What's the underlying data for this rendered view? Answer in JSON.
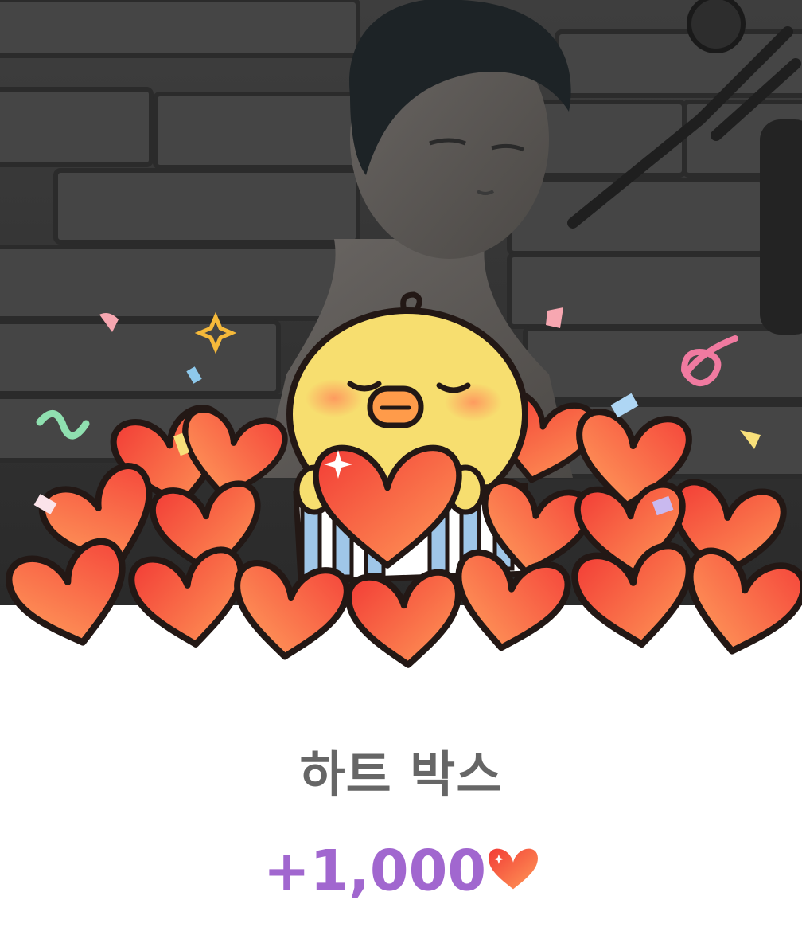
{
  "item": {
    "name": "하트 박스",
    "amount": "+1,000",
    "currency_icon": "heart-icon"
  },
  "colors": {
    "title_text": "#666666",
    "amount_text": "#a167cf",
    "heart_fill": "#f5563d",
    "heart_fill_light": "#ff9a5a",
    "chick_fill": "#f7de6f",
    "outline": "#231815"
  }
}
